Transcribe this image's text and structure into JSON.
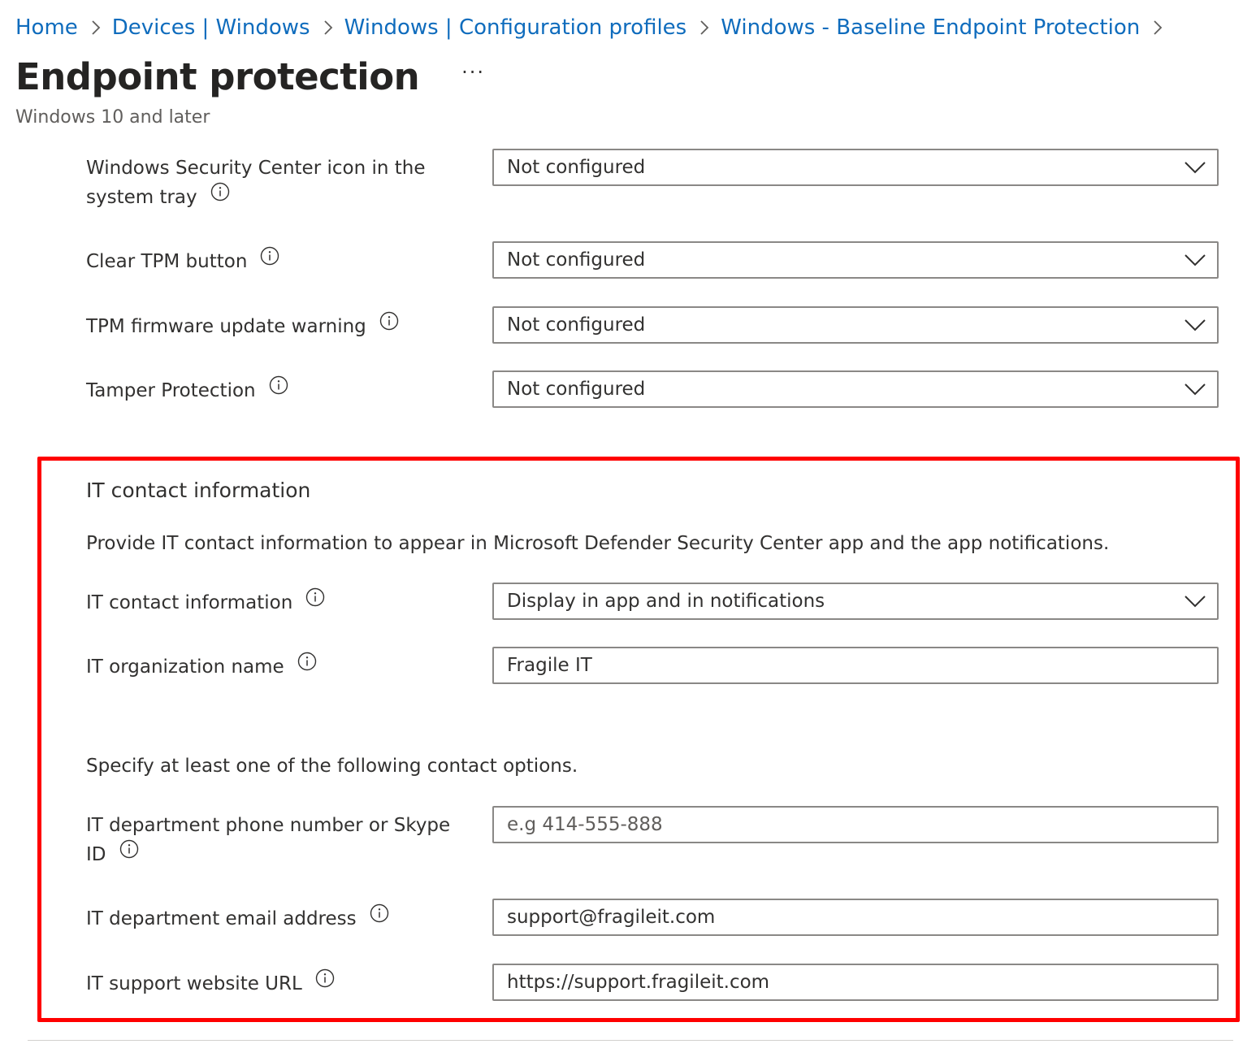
{
  "breadcrumb": {
    "items": [
      "Home",
      "Devices | Windows",
      "Windows | Configuration profiles",
      "Windows - Baseline Endpoint Protection"
    ]
  },
  "page": {
    "title": "Endpoint protection",
    "more_label": "···",
    "subtitle": "Windows 10 and later"
  },
  "settings": [
    {
      "label_line1": "Windows Security Center icon in the",
      "label_line2": "system tray",
      "value": "Not configured"
    },
    {
      "label": "Clear TPM button",
      "value": "Not configured"
    },
    {
      "label": "TPM firmware update warning",
      "value": "Not configured"
    },
    {
      "label": "Tamper Protection",
      "value": "Not configured"
    }
  ],
  "it_contact": {
    "heading": "IT contact information",
    "description": "Provide IT contact information to appear in Microsoft Defender Security Center app and the app notifications.",
    "display": {
      "label": "IT contact information",
      "value": "Display in app and in notifications"
    },
    "org_name": {
      "label": "IT organization name",
      "value": "Fragile IT"
    },
    "options_note": "Specify at least one of the following contact options.",
    "phone": {
      "label_line1": "IT department phone number or Skype",
      "label_line2": "ID",
      "value": "",
      "placeholder": "e.g 414-555-888"
    },
    "email": {
      "label": "IT department email address",
      "value": "support@fragileit.com"
    },
    "website": {
      "label": "IT support website URL",
      "value": "https://support.fragileit.com"
    }
  },
  "colors": {
    "link": "#0f6cbd",
    "highlight_border": "#ff0000",
    "input_border": "#8a8886"
  },
  "icons": [
    "chevron-right-icon",
    "info-icon",
    "chevron-down-icon",
    "more-icon"
  ]
}
